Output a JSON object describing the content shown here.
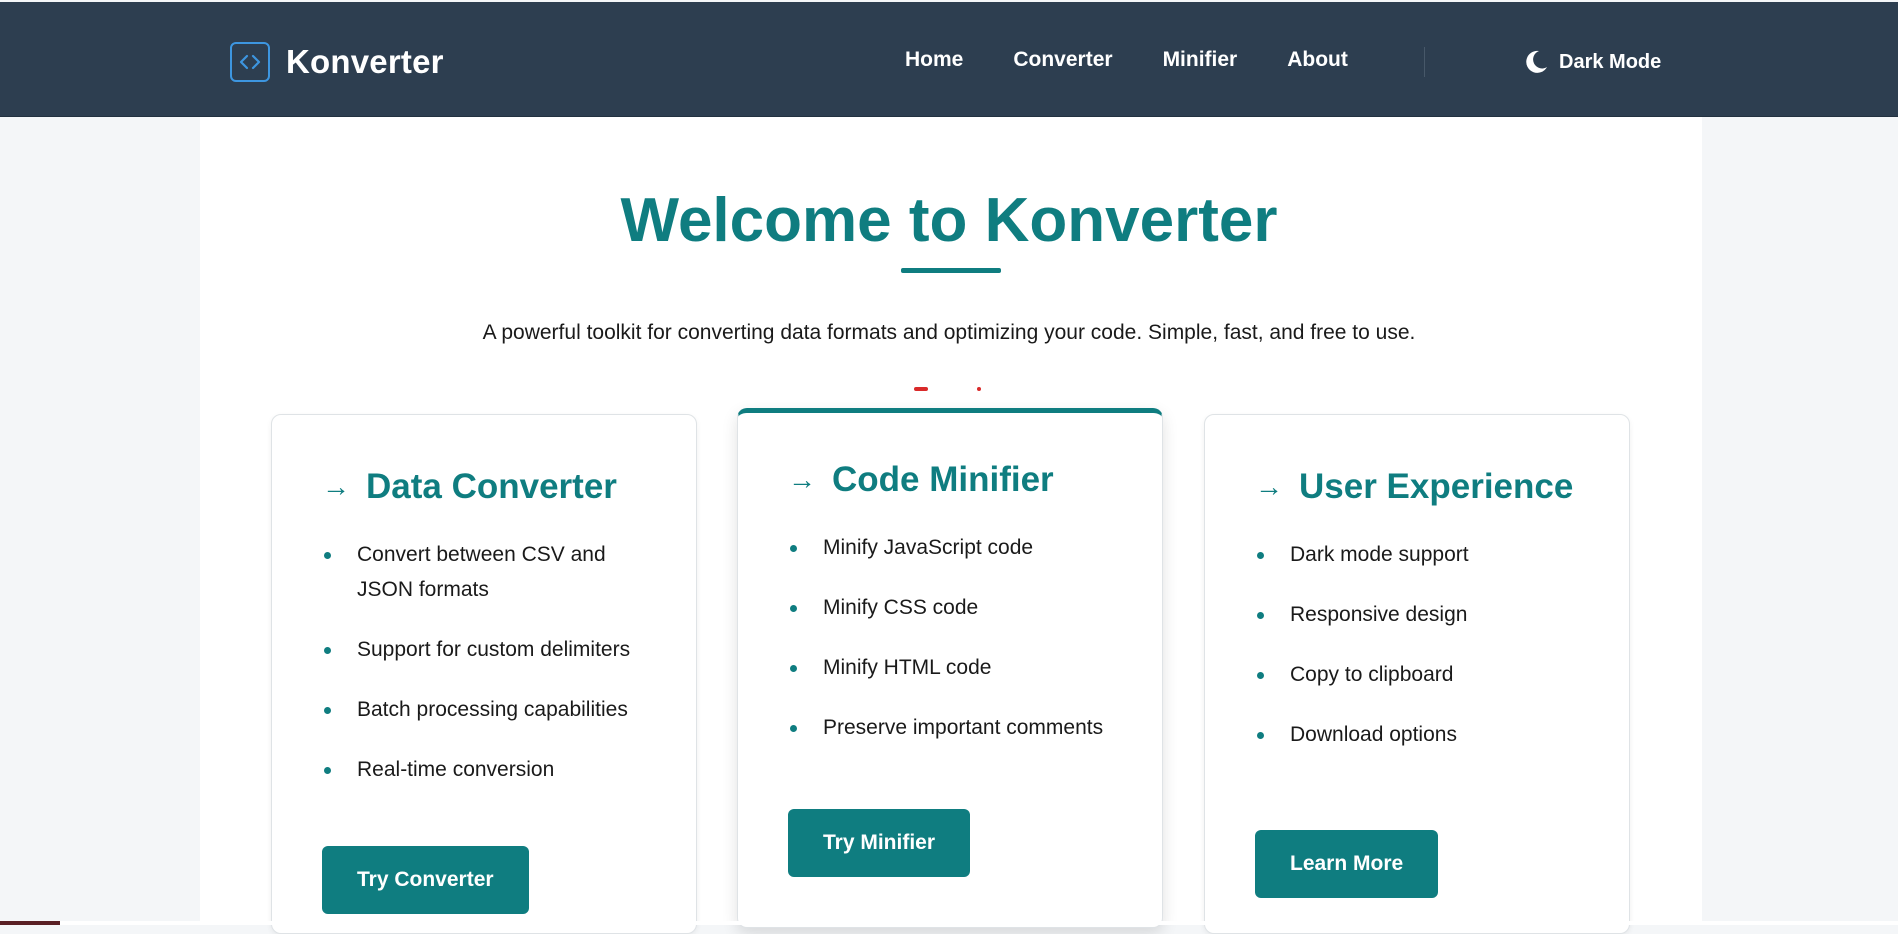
{
  "header": {
    "brand": "Konverter",
    "brand_icon": "code-brackets-icon",
    "nav": [
      "Home",
      "Converter",
      "Minifier",
      "About"
    ],
    "dark_mode_label": "Dark Mode",
    "dark_mode_icon": "moon-icon"
  },
  "hero": {
    "title": "Welcome to Konverter",
    "subtitle": "A powerful toolkit for converting data formats and optimizing your code. Simple, fast, and free to use."
  },
  "cards": [
    {
      "title": "Data Converter",
      "features": [
        "Convert between CSV and JSON formats",
        "Support for custom delimiters",
        "Batch processing capabilities",
        "Real-time conversion"
      ],
      "button": "Try Converter"
    },
    {
      "title": "Code Minifier",
      "features": [
        "Minify JavaScript code",
        "Minify CSS code",
        "Minify HTML code",
        "Preserve important comments"
      ],
      "button": "Try Minifier"
    },
    {
      "title": "User Experience",
      "features": [
        "Dark mode support",
        "Responsive design",
        "Copy to clipboard",
        "Download options"
      ],
      "button": "Learn More"
    }
  ],
  "colors": {
    "header_bg": "#2d3e50",
    "accent": "#0f7d80",
    "brand_icon": "#3d96e0"
  }
}
